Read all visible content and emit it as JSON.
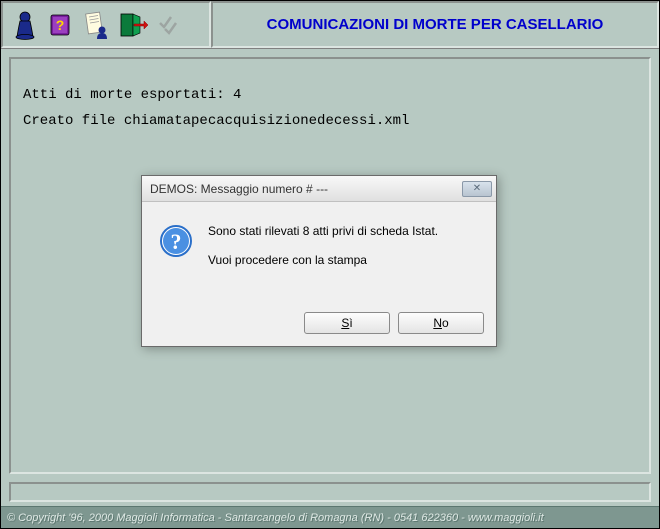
{
  "header": {
    "title": "COMUNICAZIONI DI MORTE PER CASELLARIO"
  },
  "toolbar": {
    "icons": [
      "pawn-icon",
      "help-book-icon",
      "scroll-user-icon",
      "exit-door-icon",
      "checkmarks-icon"
    ]
  },
  "content": {
    "line1": "Atti di morte esportati: 4",
    "line2": "Creato file chiamatapecacquisizionedecessi.xml"
  },
  "dialog": {
    "title": "DEMOS:  Messaggio numero #  ---",
    "message_line1": "Sono stati rilevati 8 atti privi di scheda Istat.",
    "message_line2": "Vuoi procedere con la stampa",
    "btn_yes": "Sì",
    "btn_no": "No"
  },
  "statusbar": {
    "text": "© Copyright '96, 2000 Maggioli Informatica - Santarcangelo di Romagna (RN) - 0541 622360 - www.maggioli.it"
  }
}
